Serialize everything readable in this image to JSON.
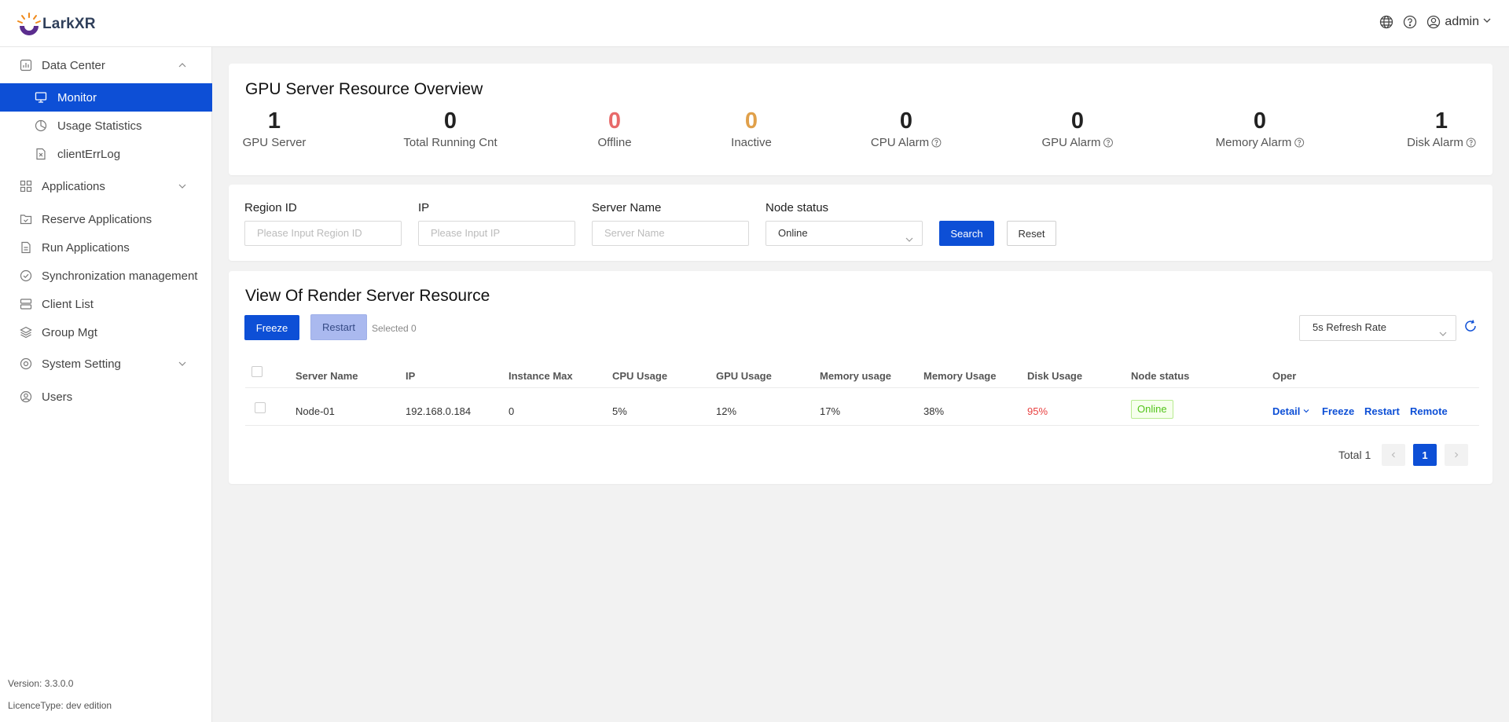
{
  "app": {
    "name": "LarkXR"
  },
  "header": {
    "user": "admin"
  },
  "sidebar": {
    "items": [
      {
        "label": "Data Center"
      },
      {
        "label": "Monitor"
      },
      {
        "label": "Usage Statistics"
      },
      {
        "label": "clientErrLog"
      },
      {
        "label": "Applications"
      },
      {
        "label": "Reserve Applications"
      },
      {
        "label": "Run Applications"
      },
      {
        "label": "Synchronization management"
      },
      {
        "label": "Client List"
      },
      {
        "label": "Group Mgt"
      },
      {
        "label": "System Setting"
      },
      {
        "label": "Users"
      }
    ],
    "version": "Version: 3.3.0.0",
    "licence": "LicenceType: dev edition"
  },
  "overview": {
    "title": "GPU Server Resource Overview",
    "stats": [
      {
        "value": "1",
        "label": "GPU Server",
        "color": "#111111"
      },
      {
        "value": "0",
        "label": "Total Running Cnt",
        "color": "#111111"
      },
      {
        "value": "0",
        "label": "Offline",
        "color": "#e86a6a"
      },
      {
        "value": "0",
        "label": "Inactive",
        "color": "#e0a04a"
      },
      {
        "value": "0",
        "label": "CPU Alarm",
        "color": "#111111"
      },
      {
        "value": "0",
        "label": "GPU Alarm",
        "color": "#111111"
      },
      {
        "value": "0",
        "label": "Memory Alarm",
        "color": "#111111"
      },
      {
        "value": "1",
        "label": "Disk Alarm",
        "color": "#111111"
      }
    ]
  },
  "filters": {
    "region_label": "Region ID",
    "region_placeholder": "Please Input Region ID",
    "ip_label": "IP",
    "ip_placeholder": "Please Input IP",
    "name_label": "Server Name",
    "name_placeholder": "Server Name",
    "status_label": "Node status",
    "status_value": "Online",
    "search": "Search",
    "reset": "Reset"
  },
  "resource": {
    "title": "View Of Render Server Resource",
    "freeze": "Freeze",
    "restart": "Restart",
    "selected": "Selected 0",
    "refresh": "5s Refresh Rate",
    "columns": [
      "Server Name",
      "IP",
      "Instance Max",
      "CPU Usage",
      "GPU Usage",
      "Memory usage",
      "Memory Usage",
      "Disk Usage",
      "Node status",
      "Oper"
    ],
    "rows": [
      {
        "name": "Node-01",
        "ip": "192.168.0.184",
        "instance_max": "0",
        "cpu": "5%",
        "gpu": "12%",
        "mem1": "17%",
        "mem2": "38%",
        "disk": "95%",
        "status": "Online"
      }
    ],
    "ops": {
      "detail": "Detail",
      "freeze": "Freeze",
      "restart": "Restart",
      "remote": "Remote"
    },
    "total": "Total 1",
    "page": "1"
  },
  "colors": {
    "primary": "#0d4fd6",
    "danger": "#e84040",
    "success": "#52c41a"
  }
}
